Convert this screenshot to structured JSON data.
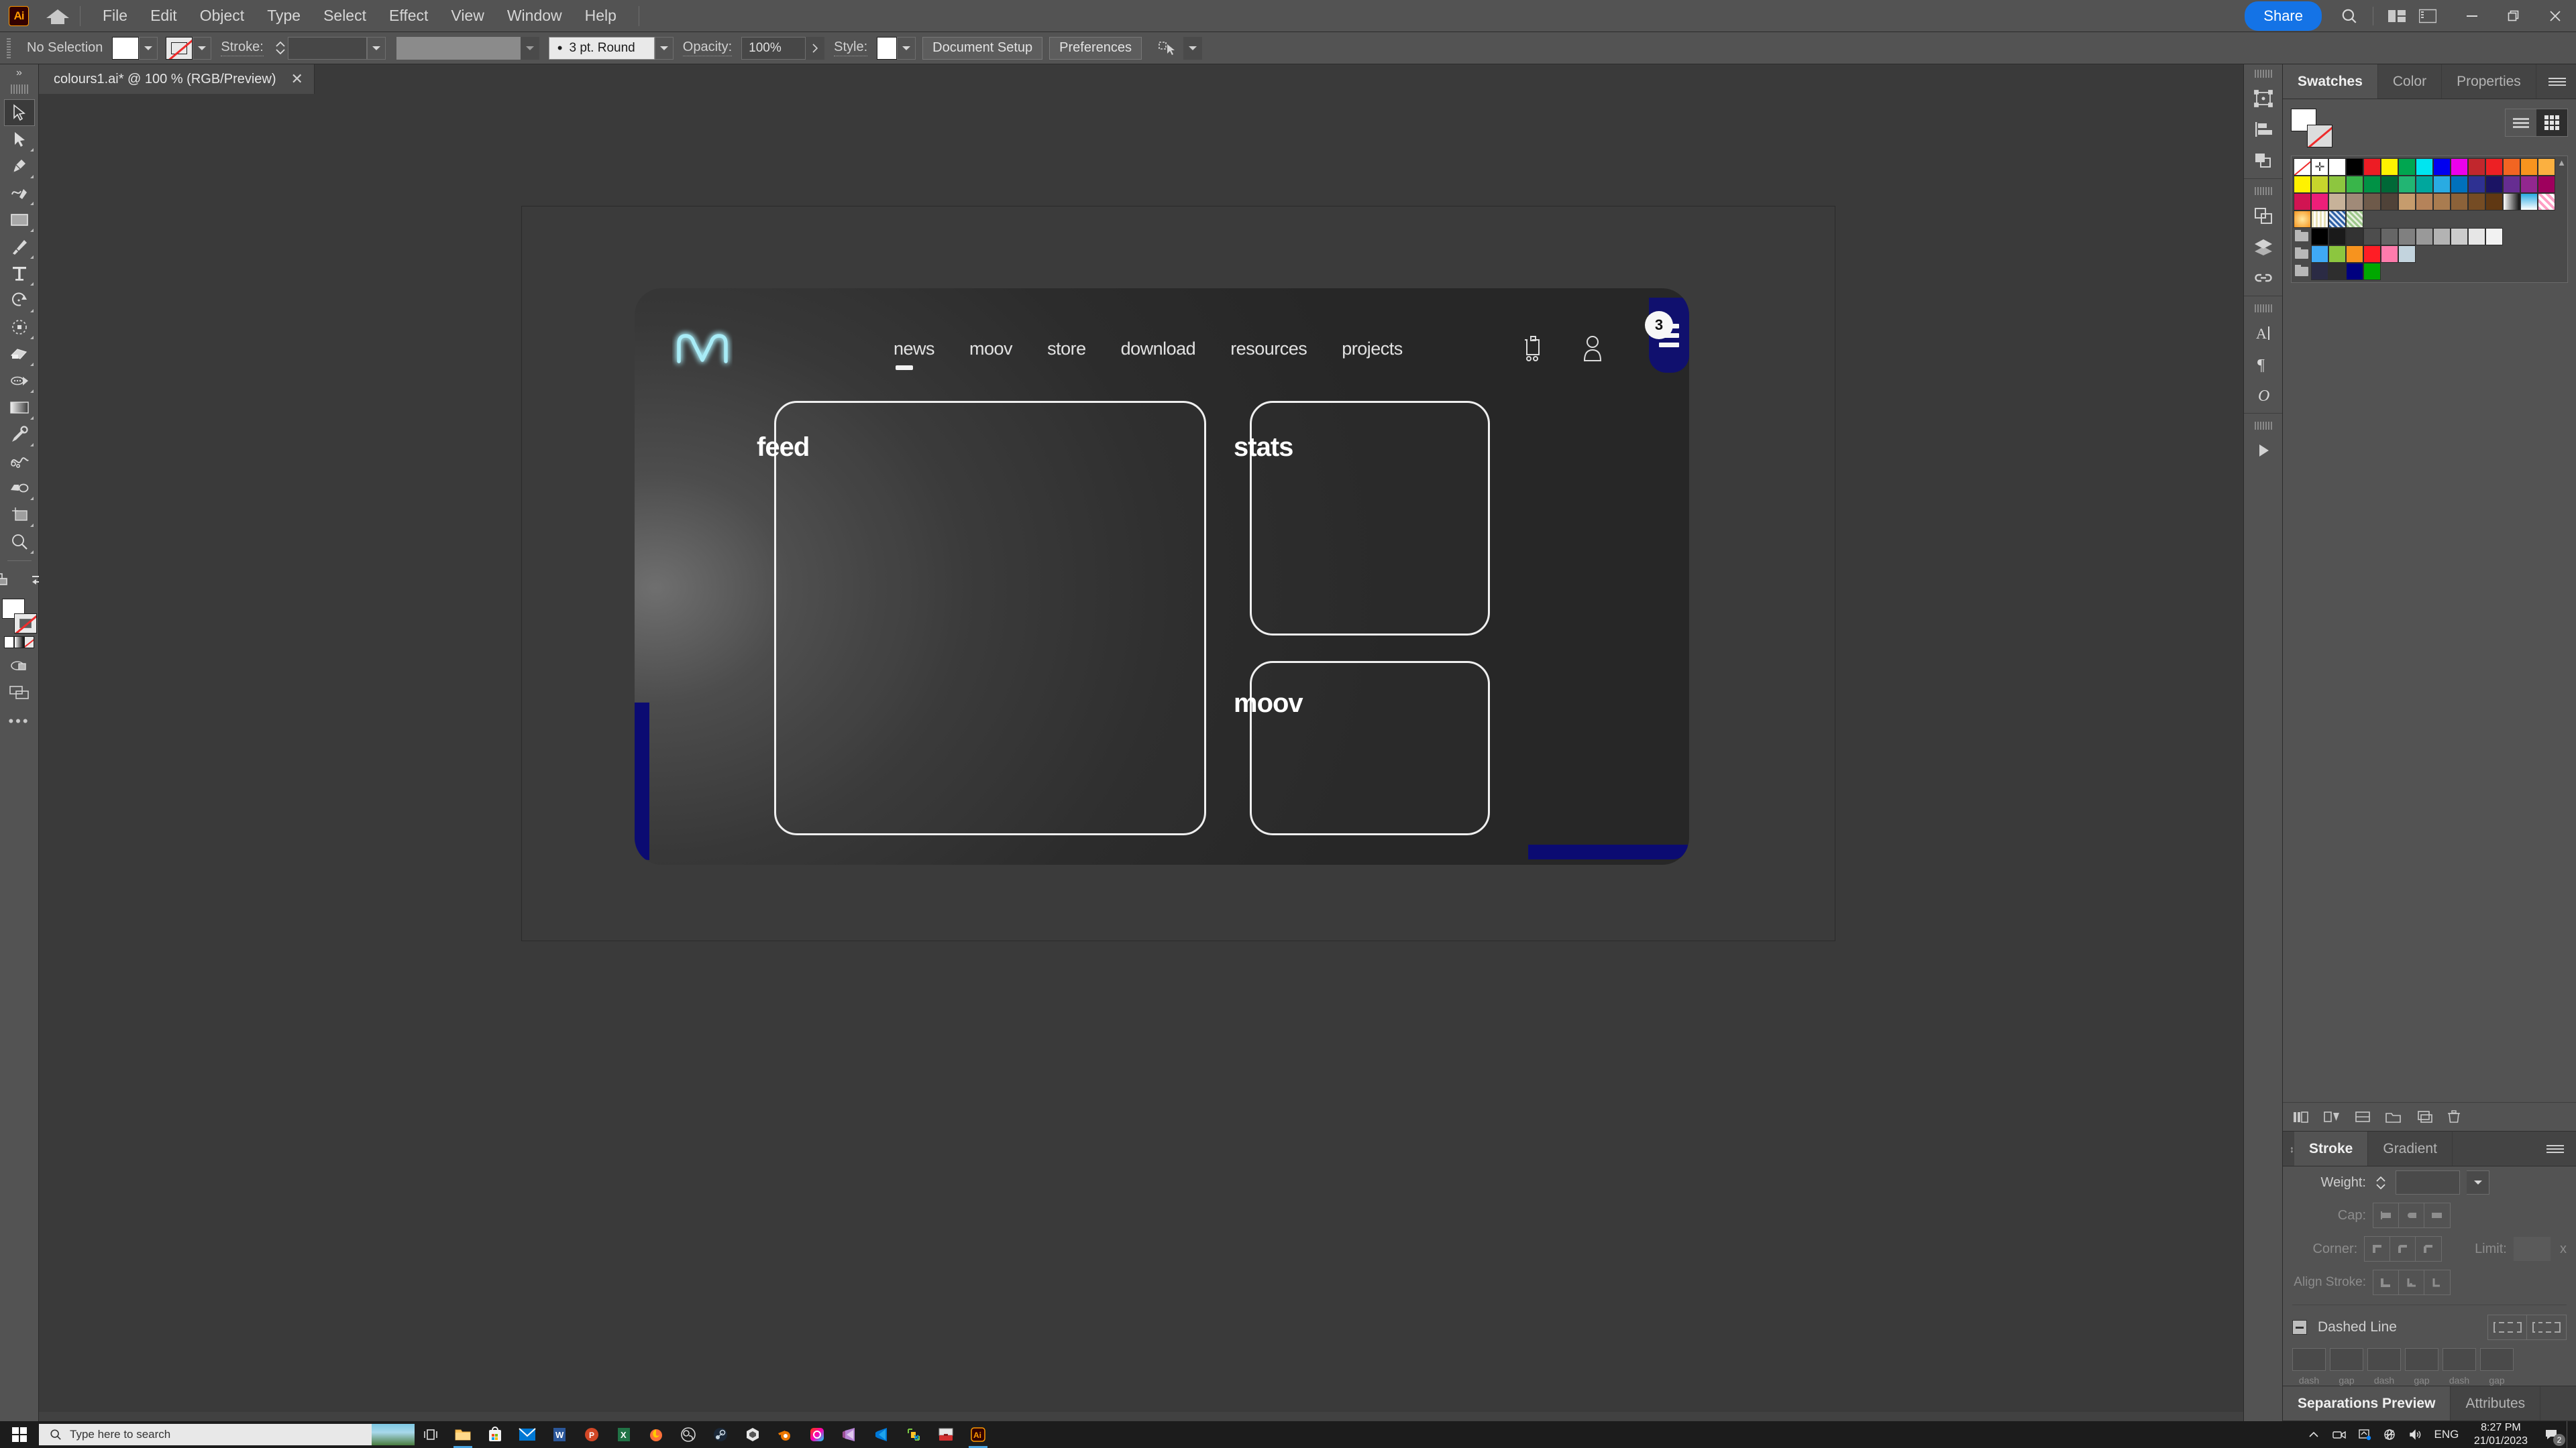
{
  "app": {
    "name": "Adobe Illustrator",
    "logo_text": "Ai",
    "home_icon": "home-icon"
  },
  "menubar": {
    "items": [
      "File",
      "Edit",
      "Object",
      "Type",
      "Select",
      "Effect",
      "View",
      "Window",
      "Help"
    ],
    "share_label": "Share",
    "search_icon": "search-icon",
    "arrange_icon": "arrange-documents-icon",
    "workspace_icon": "workspace-switcher-icon",
    "window_controls": {
      "minimize": "−",
      "maximize": "❐",
      "close": "✕"
    }
  },
  "controlbar": {
    "selection_status": "No Selection",
    "fill_swatch_color": "#ffffff",
    "stroke_swatch": "none",
    "stroke_label": "Stroke:",
    "stroke_weight_value": "",
    "variable_width_value": "",
    "brush_definition": "3 pt. Round",
    "opacity_label": "Opacity:",
    "opacity_value": "100%",
    "style_label": "Style:",
    "document_setup_label": "Document Setup",
    "preferences_label": "Preferences",
    "select_similar_icon": "select-similar-objects-icon"
  },
  "document": {
    "tab_title": "colours1.ai* @ 100 % (RGB/Preview)",
    "close_icon": "✕",
    "zoom_percent": "100 %",
    "color_mode": "RGB/Preview",
    "filename": "colours1.ai*"
  },
  "toolbar": {
    "collapse_icon": "chevron-double-right-icon",
    "tools": [
      {
        "name": "selection-tool",
        "active": true,
        "has_flyout": false
      },
      {
        "name": "direct-selection-tool",
        "active": false,
        "has_flyout": true
      },
      {
        "name": "pen-tool",
        "active": false,
        "has_flyout": true
      },
      {
        "name": "curvature-tool",
        "active": false,
        "has_flyout": true
      },
      {
        "name": "rectangle-tool",
        "active": false,
        "has_flyout": true
      },
      {
        "name": "paintbrush-tool",
        "active": false,
        "has_flyout": true
      },
      {
        "name": "type-tool",
        "active": false,
        "has_flyout": true
      },
      {
        "name": "rotate-tool",
        "active": false,
        "has_flyout": true
      },
      {
        "name": "scale-tool",
        "active": false,
        "has_flyout": true
      },
      {
        "name": "shape-builder-tool",
        "active": false,
        "has_flyout": true
      },
      {
        "name": "gradient-tool",
        "active": false,
        "has_flyout": true
      },
      {
        "name": "eyedropper-tool",
        "active": false,
        "has_flyout": true
      },
      {
        "name": "blend-tool",
        "active": false,
        "has_flyout": false
      },
      {
        "name": "eraser-tool",
        "active": false,
        "has_flyout": true
      },
      {
        "name": "artboard-tool",
        "active": false,
        "has_flyout": true
      },
      {
        "name": "zoom-tool",
        "active": false,
        "has_flyout": true
      }
    ],
    "swap_fill_stroke_icon": "swap-fill-stroke-icon",
    "default_fill_stroke_icon": "default-fill-stroke-icon",
    "fill_color": "#ffffff",
    "stroke_color": "none",
    "color_modes": [
      "solid-color",
      "gradient",
      "none"
    ],
    "more_tools_icon": "more-tools-icon"
  },
  "artwork": {
    "site": {
      "logo_name": "moov-neon-m-logo",
      "logo_color": "#9fe8f5",
      "nav_links": [
        {
          "label": "news",
          "active": true
        },
        {
          "label": "moov",
          "active": false
        },
        {
          "label": "store",
          "active": false
        },
        {
          "label": "download",
          "active": false
        },
        {
          "label": "resources",
          "active": false
        },
        {
          "label": "projects",
          "active": false
        }
      ],
      "cart_icon": "shopping-cart-icon",
      "account_icon": "user-account-icon",
      "menu_icon": "hamburger-menu-icon",
      "menu_badge": "3",
      "accent_blue": "#10106e",
      "cards": [
        {
          "name": "feed",
          "label": "feed"
        },
        {
          "name": "stats",
          "label": "stats"
        },
        {
          "name": "moov",
          "label": "moov"
        }
      ]
    }
  },
  "rail": {
    "icons": [
      "transform-panel-icon",
      "align-panel-icon",
      "pathfinder-panel-icon",
      "artboards-panel-icon",
      "layers-panel-icon",
      "links-panel-icon",
      "character-panel-icon",
      "paragraph-panel-icon",
      "glyphs-panel-icon",
      "actions-panel-icon"
    ]
  },
  "panels": {
    "top_group": {
      "tabs": [
        {
          "label": "Swatches",
          "active": true
        },
        {
          "label": "Color",
          "active": false
        },
        {
          "label": "Properties",
          "active": false
        }
      ],
      "menu_icon": "panel-menu-icon",
      "fill_color": "#ffffff",
      "stroke_color": "none",
      "view_modes": [
        "list-view",
        "grid-view"
      ],
      "active_view": "grid-view",
      "swatch_rows": [
        [
          "none",
          "registration",
          "#ffffff",
          "#000000",
          "#ed1c24",
          "#fff200",
          "#00a650",
          "#00aeef",
          "#0000f0",
          "#ec008c",
          "#c1272d",
          "#ed1c24",
          "#f26522",
          "#f7941e",
          "#fbb040"
        ],
        [
          "#fff200",
          "#c7d52c",
          "#8dc63f",
          "#39b54a",
          "#009245",
          "#006837",
          "#22b573",
          "#00a79d",
          "#29abe2",
          "#0071bc",
          "#2e3192",
          "#1b1464",
          "#662d91",
          "#92278f",
          "#9e005d"
        ],
        [
          "#ed145b",
          "#ed1e79",
          "#c7b299",
          "#a67c52",
          "#8c6239",
          "#754c24",
          "#c69c6d",
          "#b5835a",
          "#a97c50",
          "#8c6239",
          "#754c24",
          "#603813",
          "grad-bw",
          "grad-blue",
          "pattern-pink"
        ],
        [
          "grad-orange",
          "pattern-dots",
          "pattern-blue",
          "pattern-green"
        ],
        [
          "folder",
          "#000000",
          "#1a1a1a",
          "#333333",
          "#4d4d4d",
          "#666666",
          "#808080",
          "#999999",
          "#b3b3b3",
          "#cccccc",
          "#e6e6e6",
          "#f2f2f2"
        ],
        [
          "folder",
          "#3fa9f5",
          "#8cc63f",
          "#f7931e",
          "#ff1d25",
          "#ff7bac",
          "#c3d4de"
        ],
        [
          "folder",
          "#2b2b44",
          "#2e2e2e",
          "#00007f",
          "#00a800"
        ]
      ],
      "footer_icons": [
        "swatch-libraries-icon",
        "show-swatch-kinds-icon",
        "swatch-options-icon",
        "new-color-group-icon",
        "new-swatch-icon",
        "delete-swatch-icon"
      ]
    },
    "stroke_panel": {
      "tabs": [
        {
          "label": "Stroke",
          "active": true
        },
        {
          "label": "Gradient",
          "active": false
        }
      ],
      "menu_icon": "panel-menu-icon",
      "weight_label": "Weight:",
      "weight_value": "",
      "cap_label": "Cap:",
      "corner_label": "Corner:",
      "limit_label": "Limit:",
      "limit_value": "",
      "limit_unit": "x",
      "align_stroke_label": "Align Stroke:",
      "dashed_line_label": "Dashed Line",
      "dash_values": [
        "",
        "",
        "",
        "",
        "",
        ""
      ],
      "dash_sublabels": [
        "dash",
        "gap",
        "dash",
        "gap",
        "dash",
        "gap"
      ]
    },
    "bottom_panel": {
      "tabs": [
        {
          "label": "Separations Preview",
          "active": true
        },
        {
          "label": "Attributes",
          "active": false
        }
      ]
    }
  },
  "taskbar": {
    "start_icon": "windows-start-icon",
    "search_placeholder": "Type here to search",
    "search_icon": "search-icon",
    "pinned": [
      "task-view-icon",
      "file-explorer-icon",
      "microsoft-store-icon",
      "mail-icon",
      "word-icon",
      "powerpoint-icon",
      "excel-icon",
      "firefox-icon",
      "obs-studio-icon",
      "steam-icon",
      "unity-icon",
      "blender-icon",
      "creative-cloud-icon",
      "visual-studio-icon",
      "vs-code-icon",
      "autodesk-icon",
      "toolbox-icon",
      "illustrator-icon"
    ],
    "tray": {
      "show_hidden_icon": "chevron-up-icon",
      "icons": [
        "camera-icon",
        "onedrive-icon",
        "network-offline-icon",
        "volume-icon"
      ],
      "language": "ENG",
      "time": "8:27 PM",
      "date": "21/01/2023",
      "notifications_icon": "notifications-icon",
      "notifications_count": "2"
    }
  }
}
